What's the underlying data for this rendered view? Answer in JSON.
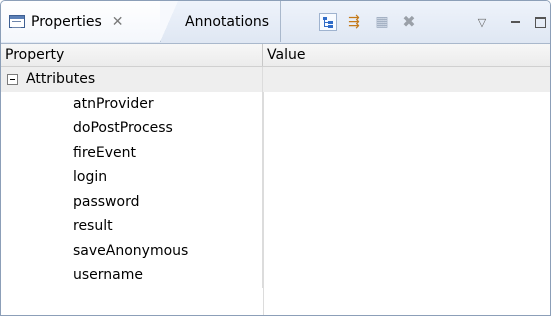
{
  "tabs": {
    "active": {
      "label": "Properties",
      "icon": "properties-view-icon",
      "close_icon": "close-icon"
    },
    "inactive": {
      "label": "Annotations"
    }
  },
  "toolbar": {
    "buttons": [
      {
        "name": "show-categories",
        "icon": "tree-icon"
      },
      {
        "name": "filter-advanced",
        "icon": "filter-icon"
      },
      {
        "name": "restore-default",
        "icon": "restore-icon"
      },
      {
        "name": "remove",
        "icon": "x-icon"
      },
      {
        "name": "view-menu",
        "icon": "chevron-down-icon"
      },
      {
        "name": "minimize",
        "icon": "minimize-icon"
      },
      {
        "name": "maximize",
        "icon": "maximize-icon"
      }
    ]
  },
  "table": {
    "columns": [
      "Property",
      "Value"
    ],
    "group": {
      "label": "Attributes",
      "expanded": true
    },
    "rows": [
      {
        "property": "atnProvider",
        "value": ""
      },
      {
        "property": "doPostProcess",
        "value": ""
      },
      {
        "property": "fireEvent",
        "value": ""
      },
      {
        "property": "login",
        "value": ""
      },
      {
        "property": "password",
        "value": ""
      },
      {
        "property": "result",
        "value": ""
      },
      {
        "property": "saveAnonymous",
        "value": ""
      },
      {
        "property": "username",
        "value": ""
      }
    ]
  }
}
